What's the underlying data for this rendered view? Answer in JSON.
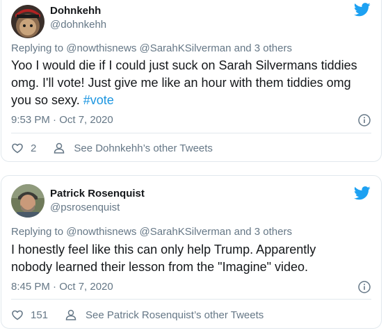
{
  "tweets": [
    {
      "name": "Dohnkehh",
      "handle": "@dohnkehh",
      "replying": "Replying to @nowthisnews @SarahKSilverman and 3 others",
      "text": "Yoo I would die if I could just suck on Sarah Silvermans tiddies omg. I'll vote! Just give me like an hour with them tiddies omg you so sexy. ",
      "hashtag": "#vote",
      "timestamp": "9:53 PM · Oct 7, 2020",
      "likes": "2",
      "see_more": "See Dohnkehh’s other Tweets"
    },
    {
      "name": "Patrick Rosenquist",
      "handle": "@psrosenquist",
      "replying": "Replying to @nowthisnews @SarahKSilverman and 3 others",
      "text": "I honestly feel like this can only help Trump. Apparently nobody learned their lesson from the \"Imagine\" video.",
      "timestamp": "8:45 PM · Oct 7, 2020",
      "likes": "151",
      "see_more": "See Patrick Rosenquist’s other Tweets"
    }
  ],
  "colors": {
    "twitter_blue": "#1da1f2",
    "link_blue": "#1b95e0",
    "muted_text": "#657786",
    "border": "#e1e8ed"
  },
  "icons": [
    "twitter-bird-icon",
    "info-icon",
    "heart-icon",
    "person-icon"
  ]
}
